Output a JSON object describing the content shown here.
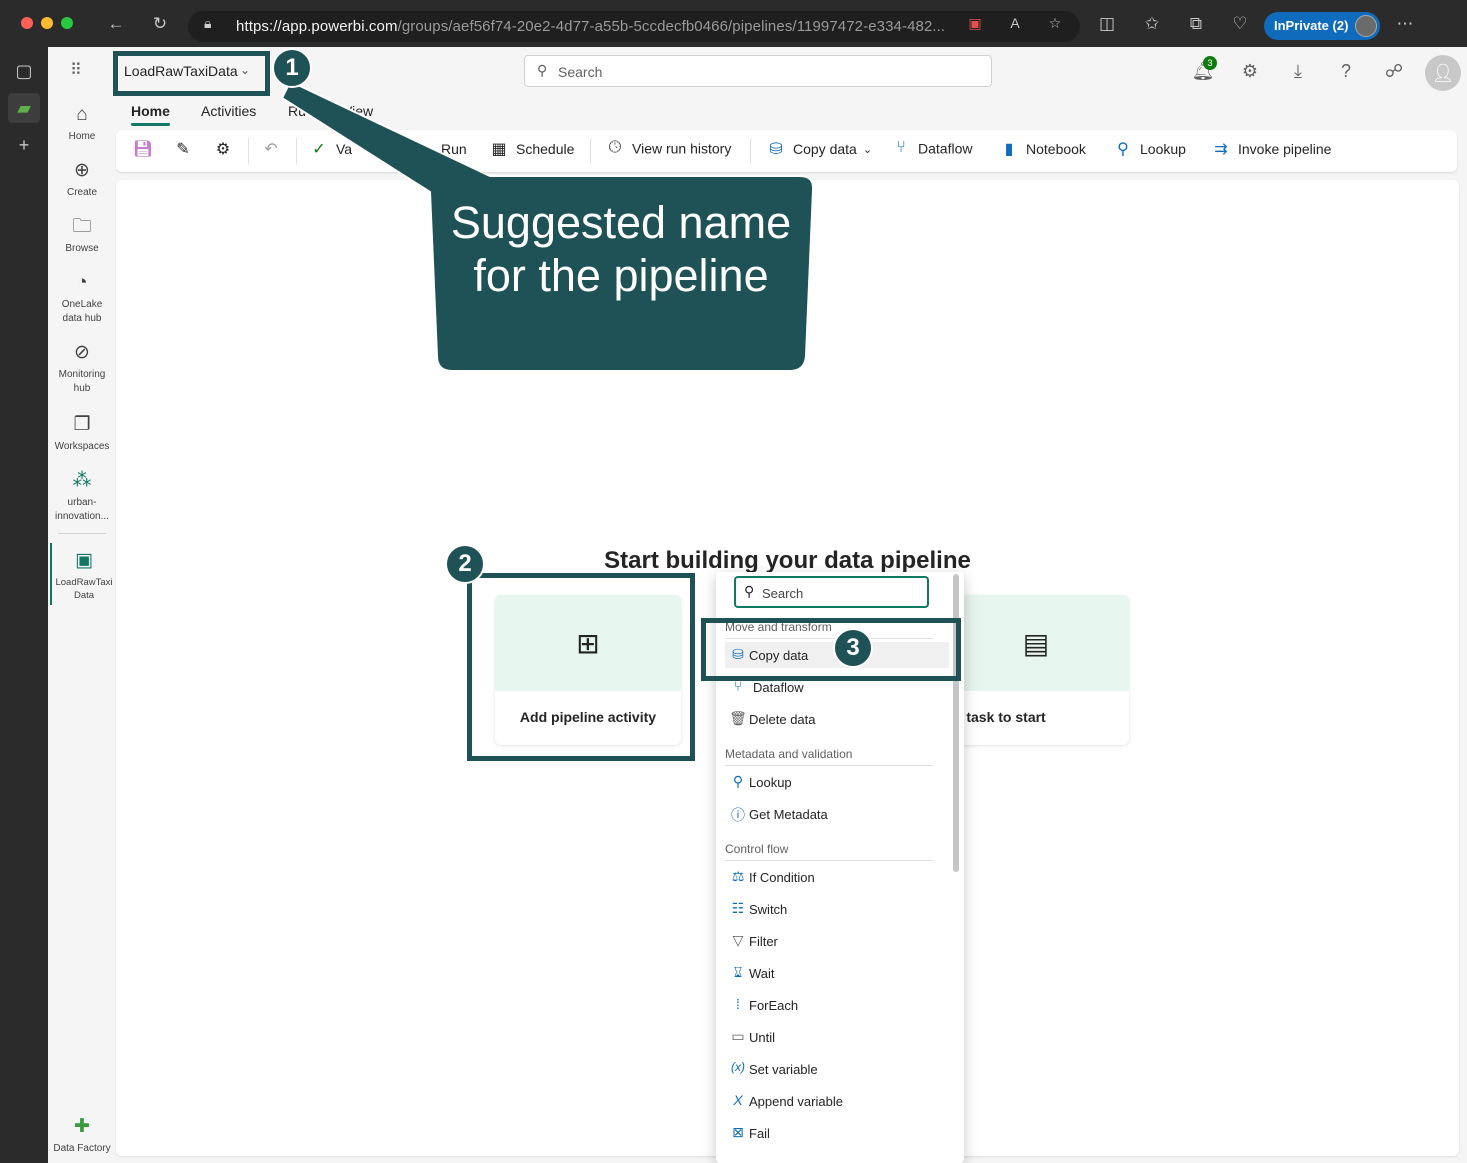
{
  "browser": {
    "url_host": "https://app.powerbi.com",
    "url_path": "/groups/aef56f74-20e2-4d77-a55b-5ccdecfb0466/pipelines/11997472-e334-482...",
    "inprivate_label": "InPrivate (2)"
  },
  "topbar": {
    "pipeline_name": "LoadRawTaxiData",
    "search_placeholder": "Search",
    "notification_count": "3"
  },
  "leftnav": {
    "items": [
      {
        "label": "Home",
        "icon": "home-icon"
      },
      {
        "label": "Create",
        "icon": "plus-circle-icon"
      },
      {
        "label": "Browse",
        "icon": "folder-icon"
      },
      {
        "label": "OneLake data hub",
        "icon": "onelake-icon"
      },
      {
        "label": "Monitoring hub",
        "icon": "monitor-icon"
      },
      {
        "label": "Workspaces",
        "icon": "workspaces-icon"
      },
      {
        "label": "urban-innovation...",
        "icon": "workspace-group-icon"
      },
      {
        "label": "LoadRawTaxiData",
        "icon": "pipeline-icon"
      }
    ],
    "footer_label": "Data Factory"
  },
  "ribbon": {
    "tabs": [
      "Home",
      "Activities",
      "Ru",
      "View"
    ],
    "validate_label": "Va",
    "run_label": "Run",
    "schedule_label": "Schedule",
    "view_run_history_label": "View run history",
    "copy_data_label": "Copy data",
    "dataflow_label": "Dataflow",
    "notebook_label": "Notebook",
    "lookup_label": "Lookup",
    "invoke_pipeline_label": "Invoke pipeline"
  },
  "canvas": {
    "title": "Start building your data pipeline",
    "card_add_activity": "Add pipeline activity",
    "card_task": "e a task to start"
  },
  "menu": {
    "search_placeholder": "Search",
    "sections": [
      {
        "header": "Move and transform",
        "items": [
          "Copy data",
          "Dataflow",
          "Delete data"
        ]
      },
      {
        "header": "Metadata and validation",
        "items": [
          "Lookup",
          "Get Metadata"
        ]
      },
      {
        "header": "Control flow",
        "items": [
          "If Condition",
          "Switch",
          "Filter",
          "Wait",
          "ForEach",
          "Until",
          "Set variable",
          "Append variable",
          "Fail"
        ]
      }
    ]
  },
  "callouts": {
    "n1": "1",
    "n2": "2",
    "n3": "3",
    "bubble_text": "Suggested name for the pipeline"
  },
  "colors": {
    "accent": "#117865",
    "callout": "#1f5257",
    "inprivate": "#0f6cbd"
  }
}
